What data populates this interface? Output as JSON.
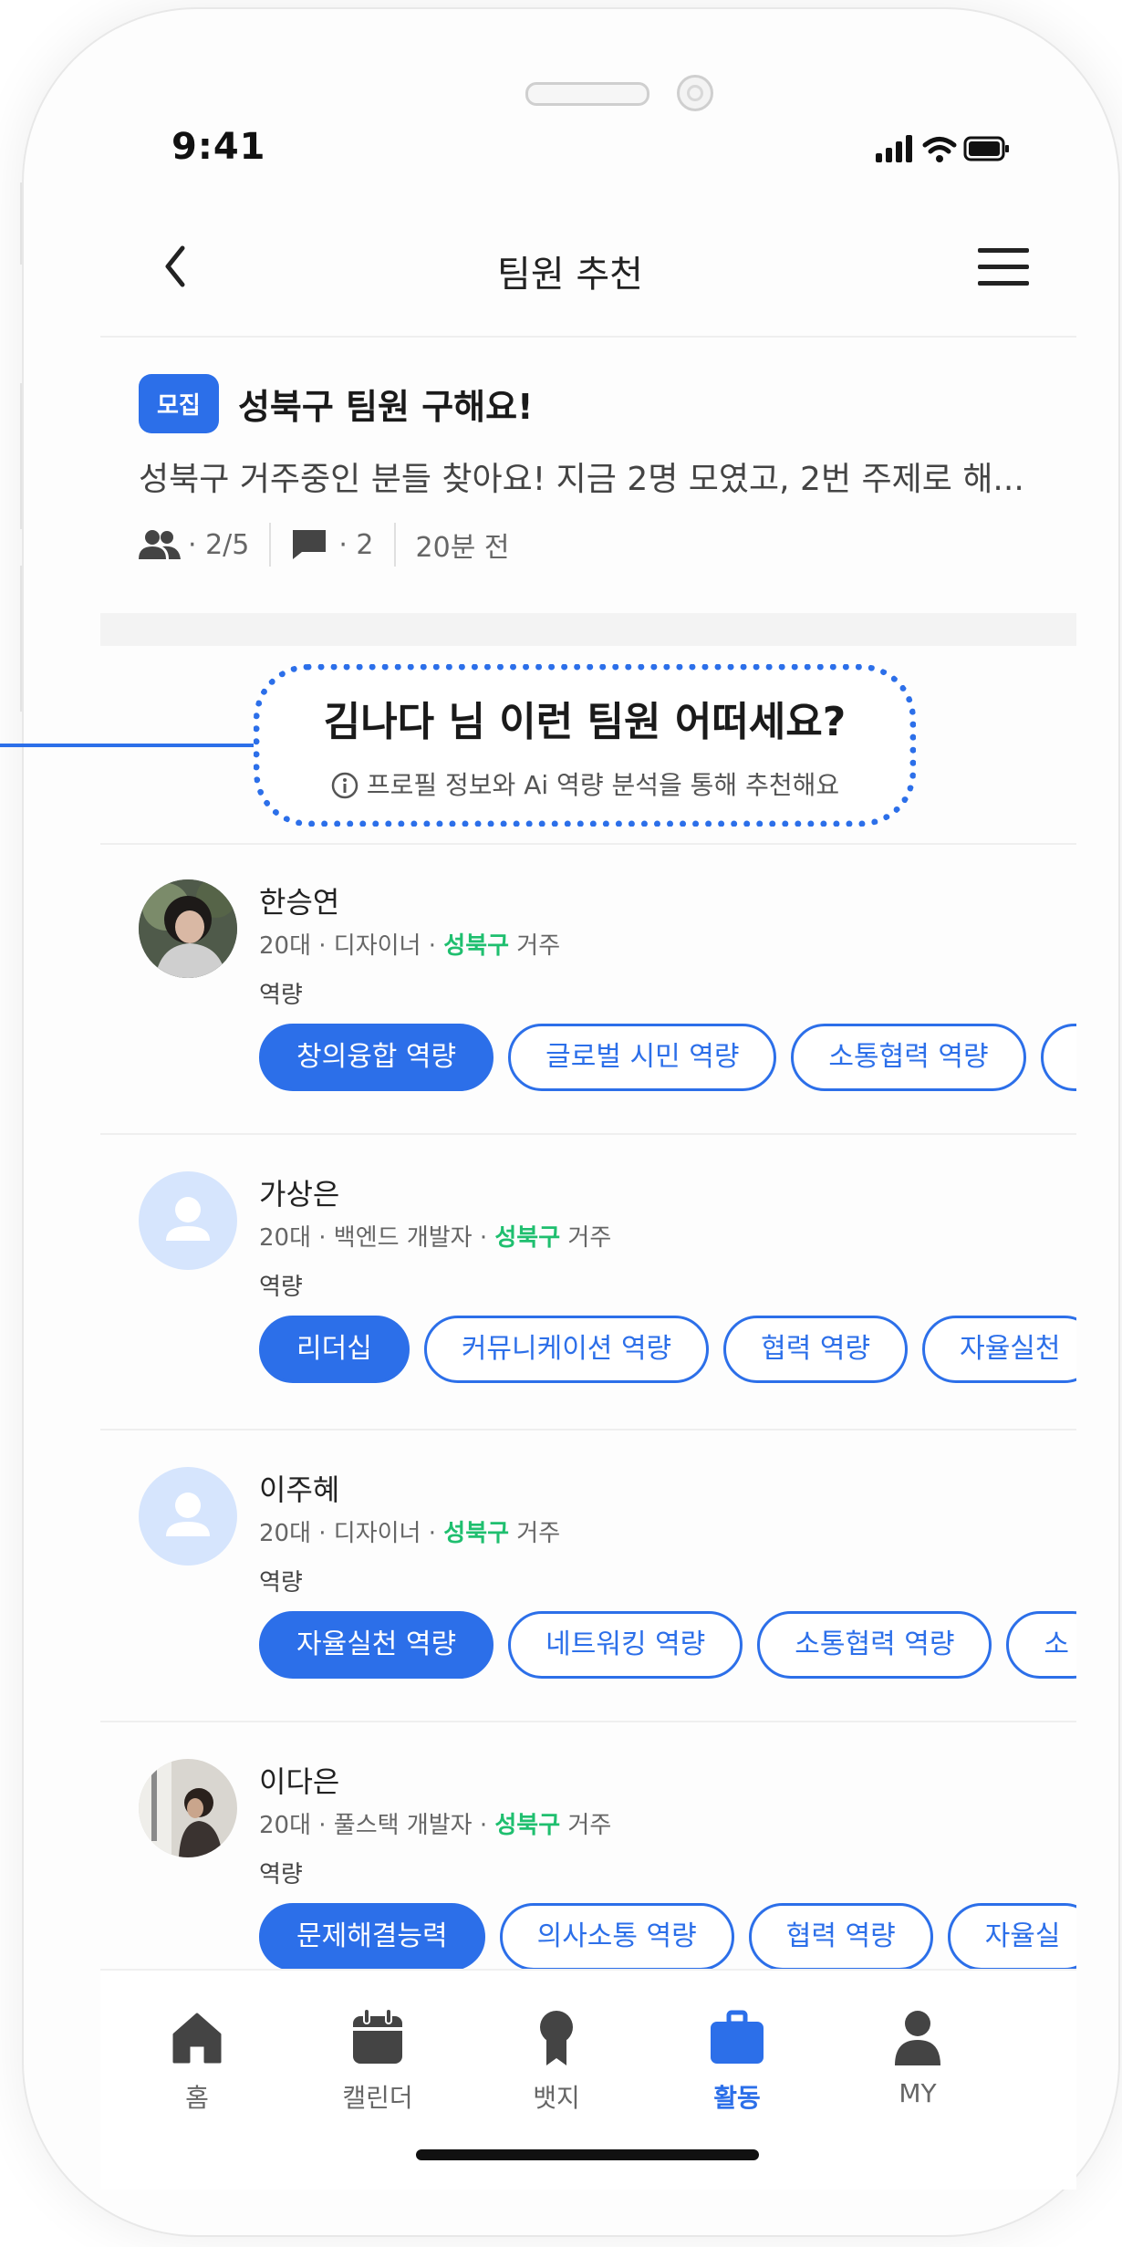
{
  "status_bar": {
    "time": "9:41"
  },
  "header": {
    "title": "팀원 추천"
  },
  "post": {
    "badge": "모집",
    "title": "성북구 팀원 구해요!",
    "body": "성북구 거주중인 분들 찾아요! 지금 2명 모였고, 2번 주제로 해...",
    "members": "· 2/5",
    "comments": "· 2",
    "time_ago": "20분 전"
  },
  "recommend": {
    "title": "김나다 님 이런 팀원 어떠세요?",
    "subtitle": "프로필 정보와 Ai 역량 분석을 통해 추천해요"
  },
  "members": [
    {
      "name": "한승연",
      "info_prefix": "20대 · 디자이너 · ",
      "location": "성북구",
      "info_suffix": " 거주",
      "label": "역량",
      "chips": [
        "창의융합 역량",
        "글로벌 시민 역량",
        "소통협력 역량",
        ""
      ]
    },
    {
      "name": "가상은",
      "info_prefix": "20대 · 백엔드 개발자 · ",
      "location": "성북구",
      "info_suffix": " 거주",
      "label": "역량",
      "chips": [
        "리더십",
        "커뮤니케이션 역량",
        "협력 역량",
        "자율실천"
      ]
    },
    {
      "name": "이주혜",
      "info_prefix": "20대 · 디자이너 · ",
      "location": "성북구",
      "info_suffix": " 거주",
      "label": "역량",
      "chips": [
        "자율실천 역량",
        "네트워킹 역량",
        "소통협력 역량",
        "소"
      ]
    },
    {
      "name": "이다은",
      "info_prefix": "20대 · 풀스택 개발자 · ",
      "location": "성북구",
      "info_suffix": " 거주",
      "label": "역량",
      "chips": [
        "문제해결능력",
        "의사소통 역량",
        "협력 역량",
        "자율실"
      ]
    }
  ],
  "nav": {
    "home": "홈",
    "calendar": "캘린더",
    "badge": "뱃지",
    "activity": "활동",
    "my": "MY"
  },
  "colors": {
    "accent": "#2c6fe9",
    "location": "#1fbf6f"
  }
}
